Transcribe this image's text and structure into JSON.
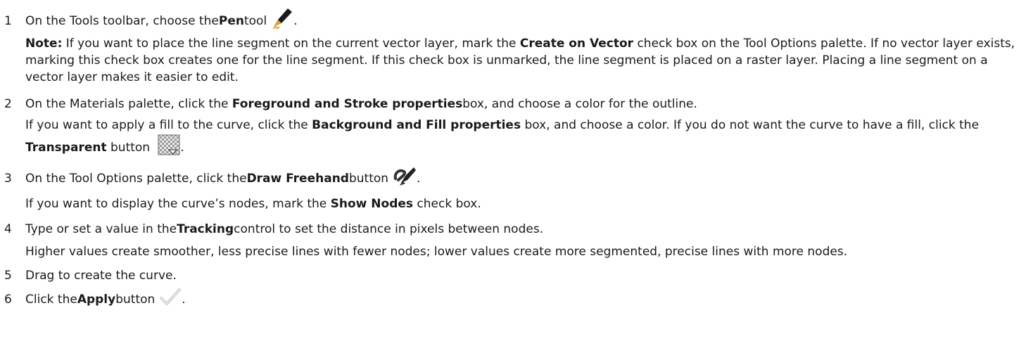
{
  "steps": [
    {
      "number": "1",
      "parts": [
        "On the Tools toolbar, choose the ",
        "Pen",
        " tool"
      ],
      "end": ".",
      "icon": "pen-icon"
    },
    {
      "number": "2",
      "parts": [
        "On the Materials palette, click the ",
        "Foreground and Stroke properties",
        " box, and choose a color for the outline."
      ]
    },
    {
      "number": "3",
      "parts": [
        "On the Tool Options palette, click the ",
        "Draw Freehand",
        " button"
      ],
      "end": ".",
      "icon": "draw-freehand-icon"
    },
    {
      "number": "4",
      "parts": [
        "Type or set a value in the ",
        "Tracking",
        " control to set the distance in pixels between nodes."
      ]
    },
    {
      "number": "5",
      "parts": [
        "Drag to create the curve."
      ]
    },
    {
      "number": "6",
      "parts": [
        "Click the ",
        "Apply",
        " button"
      ],
      "end": ".",
      "icon": "apply-checkmark-icon"
    }
  ],
  "note": {
    "label": "Note:",
    "parts": [
      " If you want to place the line segment on the current vector layer, mark the ",
      "Create on Vector",
      " check box on the Tool Options palette. If no vector layer exists, marking this check box creates one for the line segment. If this check box is unmarked, the line segment is placed on a raster layer. Placing a line segment on a vector layer makes it easier to edit."
    ]
  },
  "fill_paragraph": {
    "parts": [
      "If you want to apply a fill to the curve, click the ",
      "Background and Fill properties",
      " box, and choose a color. If you do not want the curve to have a fill, click the ",
      "Transparent",
      " button"
    ],
    "end": ".",
    "icon": "transparent-icon"
  },
  "show_nodes_paragraph": {
    "parts": [
      "If you want to display the curve’s nodes, mark the ",
      "Show Nodes",
      " check box."
    ]
  },
  "tracking_paragraph": {
    "text": "Higher values create smoother, less precise lines with fewer nodes; lower values create more segmented, precise lines with more nodes."
  }
}
